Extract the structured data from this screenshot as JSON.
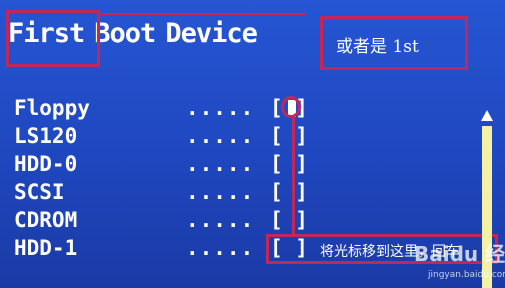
{
  "header": {
    "title_words": [
      "First",
      "Boot",
      "Device"
    ],
    "annotation_tip": "或者是 1st"
  },
  "devices": [
    {
      "label": "Floppy",
      "dots": ".....",
      "slot": "[ ]",
      "selected": true
    },
    {
      "label": "LS120",
      "dots": ".....",
      "slot": "[ ]",
      "selected": false
    },
    {
      "label": "HDD-0",
      "dots": ".....",
      "slot": "[ ]",
      "selected": false
    },
    {
      "label": "SCSI",
      "dots": ".....",
      "slot": "[ ]",
      "selected": false
    },
    {
      "label": "CDROM",
      "dots": ".....",
      "slot": "[ ]",
      "selected": false
    },
    {
      "label": "HDD-1",
      "dots": ".....",
      "slot": "[ ]",
      "selected": false
    }
  ],
  "annotation_move": "将光标移到这里，回车",
  "watermark": {
    "logo": "Baidu 经验",
    "url": "jingyan.baidu.com"
  },
  "colors": {
    "background": "#1f47bf",
    "annotation": "#c0285a",
    "scrollbar": "#f4f1a6"
  }
}
